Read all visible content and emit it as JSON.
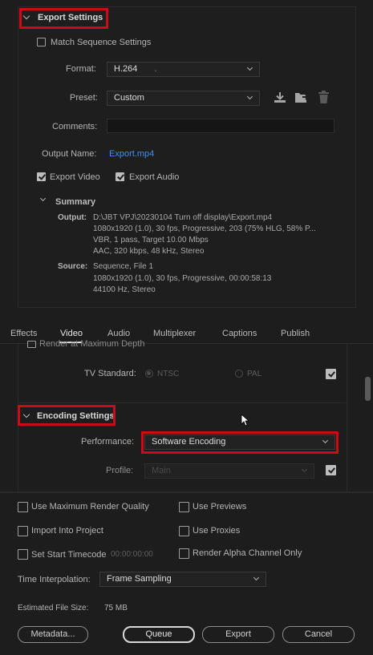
{
  "export_settings": {
    "header": "Export Settings",
    "match_sequence": {
      "label": "Match Sequence Settings",
      "checked": false
    },
    "format": {
      "label": "Format:",
      "value": "H.264"
    },
    "preset": {
      "label": "Preset:",
      "value": "Custom"
    },
    "comments": {
      "label": "Comments:",
      "value": ""
    },
    "output_name": {
      "label": "Output Name:",
      "value": "Export.mp4"
    },
    "export_video": {
      "label": "Export Video",
      "checked": true
    },
    "export_audio": {
      "label": "Export Audio",
      "checked": true
    },
    "summary": {
      "header": "Summary",
      "output_label": "Output:",
      "output_lines": [
        "D:\\JBT VPJ\\20230104 Turn off display\\Export.mp4",
        "1080x1920 (1.0), 30 fps, Progressive, 203 (75% HLG, 58% P...",
        "VBR, 1 pass, Target 10.00 Mbps",
        "AAC, 320 kbps, 48 kHz, Stereo"
      ],
      "source_label": "Source:",
      "source_lines": [
        "Sequence, File 1",
        "1080x1920 (1.0), 30 fps, Progressive, 00:00:58:13",
        "44100 Hz, Stereo"
      ]
    }
  },
  "tabs": [
    "Effects",
    "Video",
    "Audio",
    "Multiplexer",
    "Captions",
    "Publish"
  ],
  "active_tab": "Video",
  "video": {
    "render_max_depth": "Render at Maximum Depth",
    "tv_standard": {
      "label": "TV Standard:",
      "options": [
        "NTSC",
        "PAL"
      ],
      "selected": "NTSC"
    },
    "encoding_header": "Encoding Settings",
    "performance": {
      "label": "Performance:",
      "value": "Software Encoding"
    },
    "profile": {
      "label": "Profile:",
      "value": "Main"
    }
  },
  "bottom": {
    "use_max_render_quality": "Use Maximum Render Quality",
    "use_previews": "Use Previews",
    "import_into_project": "Import Into Project",
    "use_proxies": "Use Proxies",
    "set_start_timecode": "Set Start Timecode",
    "timecode": "00:00:00:00",
    "render_alpha": "Render Alpha Channel Only",
    "time_interpolation": {
      "label": "Time Interpolation:",
      "value": "Frame Sampling"
    },
    "estimated_file_size": {
      "label": "Estimated File Size:",
      "value": "75 MB"
    }
  },
  "buttons": {
    "metadata": "Metadata...",
    "queue": "Queue",
    "export": "Export",
    "cancel": "Cancel"
  },
  "colors": {
    "accent_link": "#3e8ff0",
    "highlight_red": "#cc0b17",
    "background": "#1d1d1d"
  }
}
